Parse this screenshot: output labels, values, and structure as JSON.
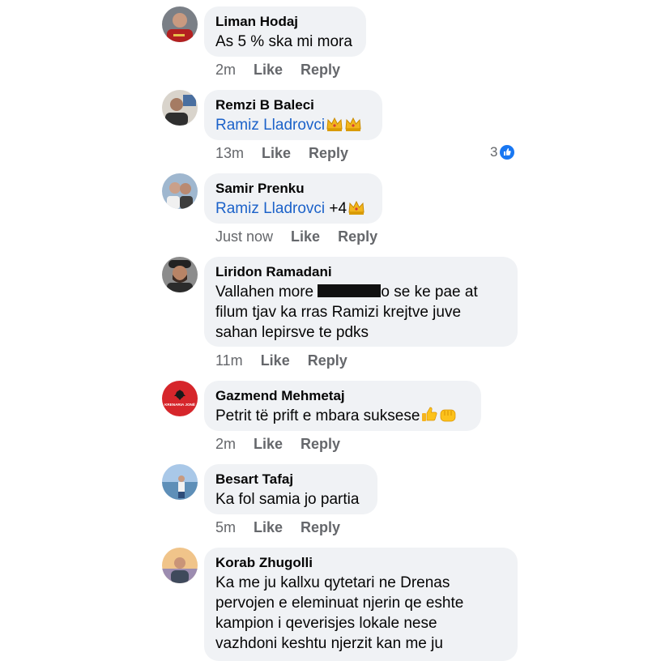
{
  "comments": [
    {
      "author": "Liman Hodaj",
      "text": "As 5 % ska mi mora",
      "time": "2m",
      "like": "Like",
      "reply": "Reply"
    },
    {
      "author": "Remzi B Baleci",
      "mention": "Ramiz Lladrovci",
      "time": "13m",
      "like": "Like",
      "reply": "Reply",
      "reactions": "3",
      "emojis": [
        "crown",
        "crown"
      ]
    },
    {
      "author": "Samir Prenku",
      "mention": "Ramiz Lladrovci",
      "suffix": " +4",
      "time": "Just now",
      "like": "Like",
      "reply": "Reply",
      "emojis": [
        "crown"
      ]
    },
    {
      "author": "Liridon Ramadani",
      "text_a": "Vallahen more ",
      "text_b": "o se ke pae at",
      "line2": "filum tjav ka rras Ramizi krejtve juve",
      "line3": "sahan lepirsve te pdks",
      "time": "11m",
      "like": "Like",
      "reply": "Reply"
    },
    {
      "author": "Gazmend Mehmetaj",
      "text": "Petrit të prift e mbara suksese",
      "time": "2m",
      "like": "Like",
      "reply": "Reply",
      "emojis": [
        "thumbs-up",
        "fist"
      ],
      "avatar_text": "KRENARIA JONË"
    },
    {
      "author": "Besart Tafaj",
      "text": "Ka fol samia jo partia",
      "time": "5m",
      "like": "Like",
      "reply": "Reply"
    },
    {
      "author": "Korab Zhugolli",
      "line1": "Ka me ju kallxu qytetari ne Drenas",
      "line2": "pervojen e eleminuat njerin qe eshte",
      "line3": "kampion i qeverisjes lokale nese",
      "line4": "vazhdoni keshtu njerzit kan me ju"
    }
  ],
  "colors": {
    "bubble": "#f0f2f5",
    "mention": "#1c62c9",
    "meta": "#65676b",
    "like_blue": "#1877f2"
  }
}
